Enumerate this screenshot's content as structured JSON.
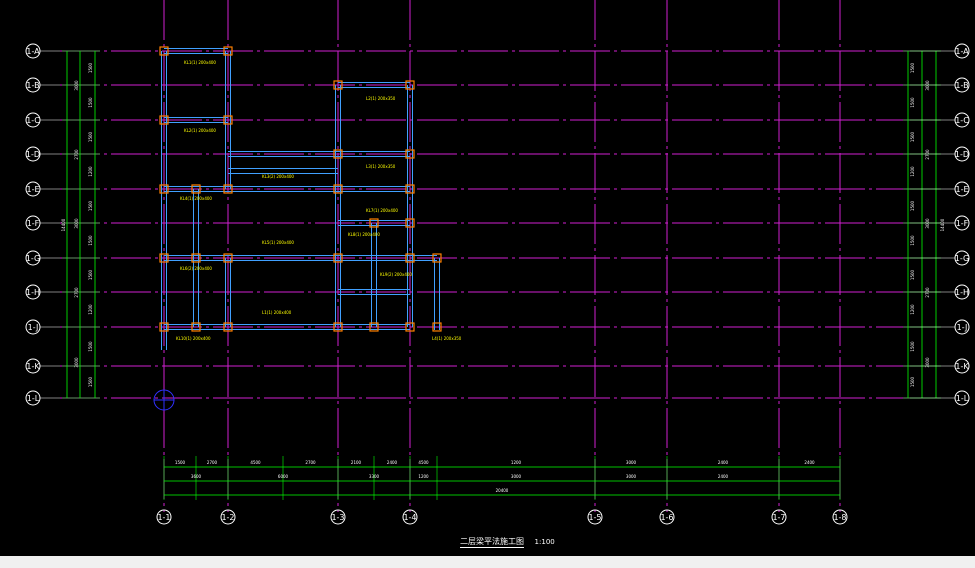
{
  "drawing": {
    "title": "二层梁平法施工图",
    "scale": "1:100",
    "colors": {
      "background": "#000000",
      "axis_line": "#d020d0",
      "dimension_line": "#00ff00",
      "beam_line": "#40a0ff",
      "beam_tag": "#ffff00",
      "column_fill": "#ff8000",
      "bubble": "#ffffff",
      "status_strip": "#f0f0f0"
    }
  },
  "horizontal_axes": [
    "1-A",
    "1-B",
    "1-C",
    "1-D",
    "1-E",
    "1-F",
    "1-G",
    "1-H",
    "1-J",
    "1-K",
    "1-L"
  ],
  "vertical_axes": [
    "1-1",
    "1-2",
    "1-3",
    "1-4",
    "1-5",
    "1-6",
    "1-7",
    "1-8"
  ],
  "dimensions": {
    "bottom_row_1": [
      "1500",
      "2700",
      "4500",
      "2700",
      "2100",
      "2400",
      "4500",
      "1200",
      "3000",
      "2400",
      "2400"
    ],
    "bottom_row_2": [
      "3600",
      "6000",
      "3300",
      "1200",
      "3000",
      "3000",
      "2400"
    ],
    "bottom_total": [
      "20400"
    ],
    "side_row_1": [
      "1500",
      "1500",
      "1500",
      "1200",
      "1500",
      "1500",
      "1500",
      "1200",
      "1500",
      "1500"
    ],
    "side_row_2": [
      "3000",
      "2700",
      "3000",
      "2700",
      "3000"
    ],
    "side_total": [
      "14400"
    ]
  },
  "beam_tags": [
    "KL1(1) 200x400",
    "KL2(1) 200x400",
    "KL3(2) 200x400",
    "KL4(1) 200x400",
    "KL5(1) 200x400",
    "KL6(2) 200x400",
    "L1(1) 200x400",
    "L2(1) 200x350",
    "L3(1) 200x350",
    "KL7(1) 200x400",
    "KL8(1) 200x400",
    "KL9(2) 200x400",
    "L4(1) 200x350",
    "KL10(1) 200x400"
  ]
}
